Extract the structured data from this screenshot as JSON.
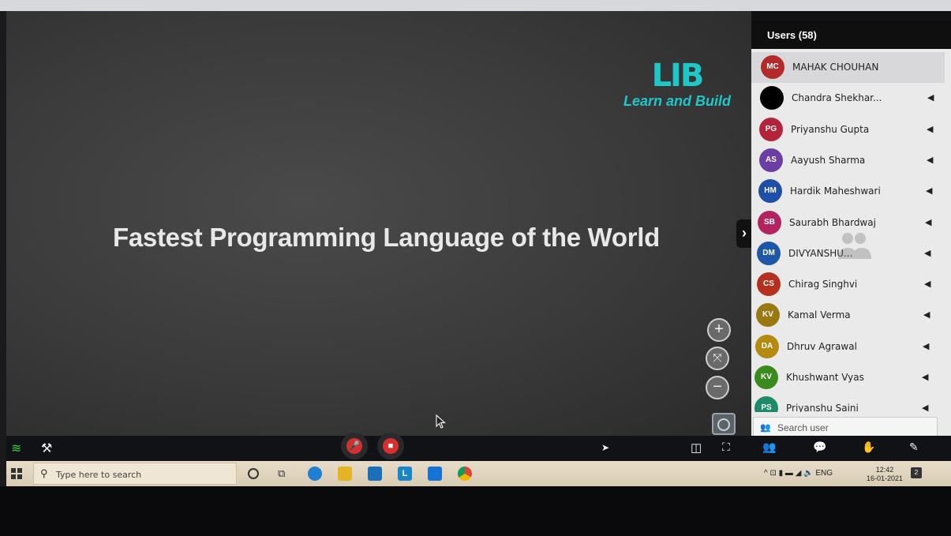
{
  "slide": {
    "logo_mark": "LIB",
    "logo_tagline": "Learn and Build",
    "title": "Fastest Programming Language of the World",
    "zoom_in": "+",
    "zoom_reset": "⤧",
    "zoom_out": "−"
  },
  "users_panel": {
    "header": "Users (58)",
    "expand_glyph": "›",
    "search_placeholder": "Search user",
    "users": [
      {
        "initials": "MC",
        "name": "MAHAK CHOUHAN",
        "color": "#b22a2a",
        "muted": false
      },
      {
        "initials": "",
        "name": "Chandra Shekhar...",
        "color": "#000000",
        "muted": true
      },
      {
        "initials": "PG",
        "name": "Priyanshu Gupta",
        "color": "#b3243c",
        "muted": true
      },
      {
        "initials": "AS",
        "name": "Aayush Sharma",
        "color": "#6a3ea3",
        "muted": true
      },
      {
        "initials": "HM",
        "name": "Hardik Maheshwari",
        "color": "#1e4fa8",
        "muted": true
      },
      {
        "initials": "SB",
        "name": "Saurabh Bhardwaj",
        "color": "#b3245e",
        "muted": true
      },
      {
        "initials": "DM",
        "name": "DIVYANSHU...",
        "color": "#1e56a8",
        "muted": true
      },
      {
        "initials": "CS",
        "name": "Chirag Singhvi",
        "color": "#b5301f",
        "muted": true
      },
      {
        "initials": "KV",
        "name": "Kamal Verma",
        "color": "#9a7a10",
        "muted": true
      },
      {
        "initials": "DA",
        "name": "Dhruv Agrawal",
        "color": "#b58a10",
        "muted": true
      },
      {
        "initials": "KV",
        "name": "Khushwant Vyas",
        "color": "#3a8a1e",
        "muted": true
      },
      {
        "initials": "PS",
        "name": "Priyanshu Saini",
        "color": "#1f8a6a",
        "muted": true
      }
    ]
  },
  "taskbar": {
    "search_placeholder": "Type here to search",
    "tray_text": "^  ⊡  ▮  ▬  ◢  🔈  ENG",
    "time": "12:42",
    "date": "16-01-2021",
    "notification_count": "2"
  },
  "colors": {
    "brand_teal": "#1ec8c8",
    "mute_red": "#d62f2f"
  }
}
